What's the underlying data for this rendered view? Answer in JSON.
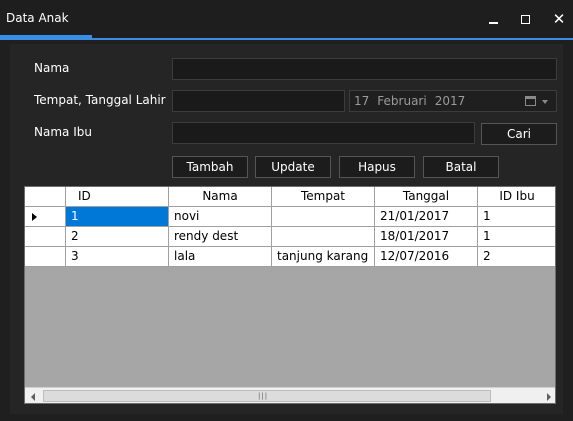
{
  "window": {
    "title": "Data Anak",
    "controls": [
      "minimize-icon",
      "maximize-icon",
      "close-icon"
    ],
    "close_glyph": "✕"
  },
  "form": {
    "nama_label": "Nama",
    "nama_value": "",
    "ttl_label": "Tempat, Tanggal Lahir",
    "tempat_value": "",
    "date": {
      "day": "17",
      "month": "Februari",
      "year": "2017"
    },
    "nama_ibu_label": "Nama Ibu",
    "nama_ibu_value": "",
    "cari_label": "Cari"
  },
  "actions": {
    "tambah": "Tambah",
    "update": "Update",
    "hapus": "Hapus",
    "batal": "Batal"
  },
  "table": {
    "columns": [
      "ID",
      "Nama",
      "Tempat",
      "Tanggal",
      "ID Ibu"
    ],
    "rows": [
      [
        "1",
        "novi",
        "",
        "21/01/2017",
        "1"
      ],
      [
        "2",
        "rendy dest",
        "",
        "18/01/2017",
        "1"
      ],
      [
        "3",
        "lala",
        "tanjung karang",
        "12/07/2016",
        "2"
      ]
    ],
    "selected_row": 0
  },
  "colors": {
    "accent": "#3a8ee6",
    "selection": "#0078d7",
    "grid_empty": "#a6a6a6"
  }
}
